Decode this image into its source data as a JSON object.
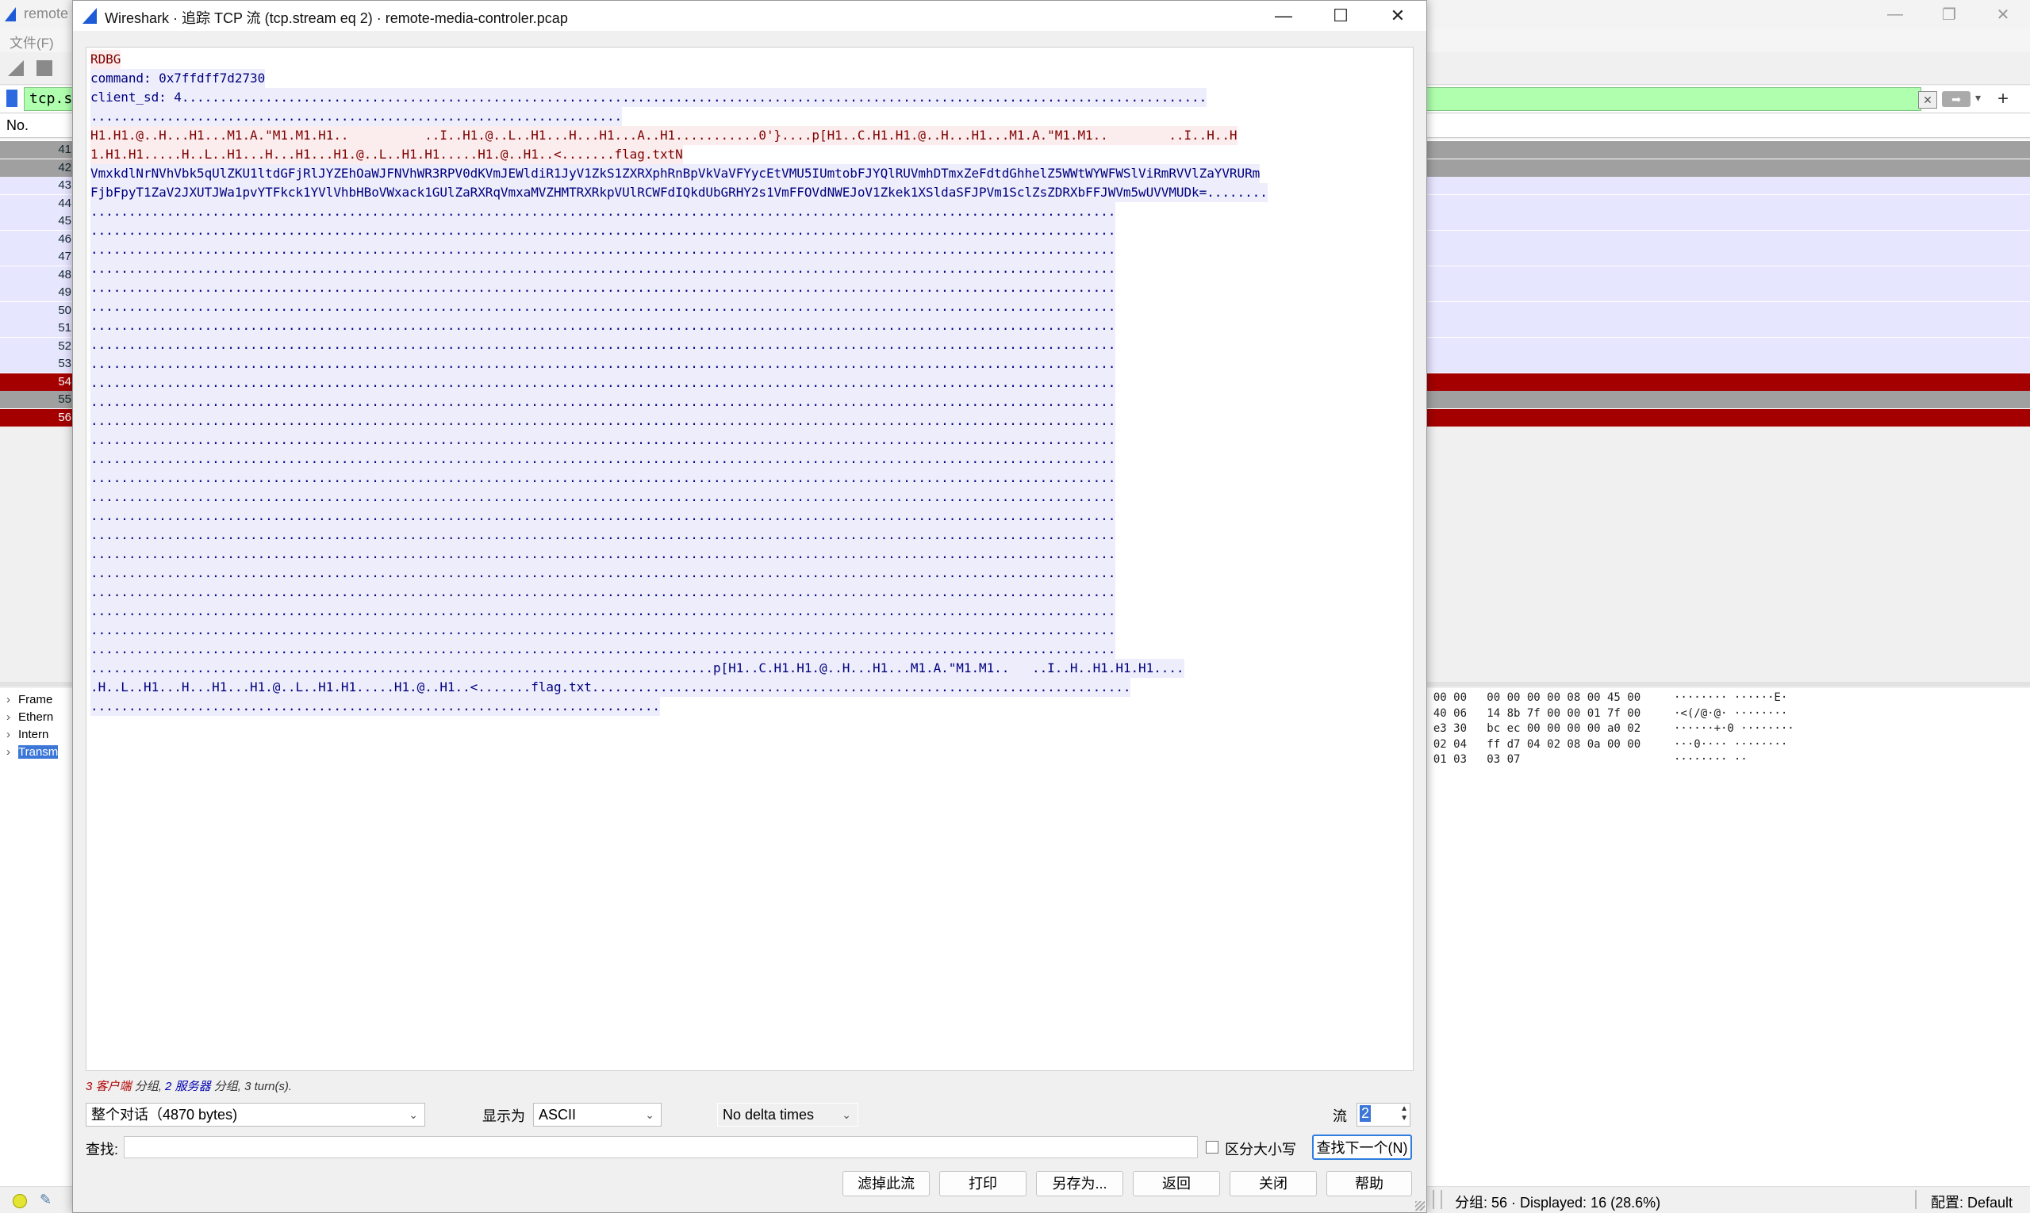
{
  "background": {
    "title": "remote",
    "menu_file": "文件(F)",
    "filter_text": "tcp.str",
    "packet_header_no": "No.",
    "packet_numbers": [
      "41",
      "42",
      "43",
      "44",
      "45",
      "46",
      "47",
      "48",
      "49",
      "50",
      "51",
      "52",
      "53",
      "54",
      "55",
      "56"
    ],
    "tree_items": [
      "Frame",
      "Ethern",
      "Intern",
      "Transm"
    ],
    "hex_lines": [
      "0 00 00   00 00 00 00 08 00 45 00",
      "0 40 06   14 8b 7f 00 00 01 7f 00",
      "0 e3 30   bc ec 00 00 00 00 a0 02",
      "0 02 04   ff d7 04 02 08 0a 00 00",
      "0 01 03   03 07"
    ],
    "ascii_lines": [
      "········ ······E·",
      "·<(/@·@· ········",
      "······+·0 ········",
      "···0···· ········",
      "········ ··"
    ],
    "status_packets": "分组: 56 · Displayed: 16 (28.6%)",
    "status_profile": "配置: Default",
    "colors": {
      "filter_ok": "#afffaf",
      "client": "#7f0000",
      "server": "#00007f",
      "bad_row": "#a40000"
    }
  },
  "dialog": {
    "title": "Wireshark · 追踪 TCP 流 (tcp.stream eq 2) · remote-media-controler.pcap",
    "stream_lines": [
      {
        "t": "RDBG",
        "s": "c"
      },
      {
        "t": "command: 0x7ffdff7d2730",
        "s": "s"
      },
      {
        "t": "client_sd: 4.......................................................................................................................................",
        "s": "s"
      },
      {
        "t": "......................................................................",
        "s": "s"
      },
      {
        "t": "H1.H1.@..H...H1...M1.A.\"M1.M1.H1..          ..I..H1.@..L..H1...H...H1...A..H1...........0'}....p[H1..C.H1.H1.@..H...H1...M1.A.\"M1.M1..        ..I..H..H",
        "s": "c"
      },
      {
        "t": "1.H1.H1.....H..L..H1...H...H1...H1.@..L..H1.H1.....H1.@..H1..<.......flag.txtN",
        "s": "c"
      },
      {
        "t": "VmxkdlNrNVhVbk5qUlZKU1ltdGFjRlJYZEhOaWJFNVhWR3RPV0dKVmJEWldiR1JyV1ZkS1ZXRXphRnBpVkVaVFYycEtVMU5IUmtobFJYQlRUVmhDTmxZeFdtdGhhelZ5WWtWYWFWSlViRmRVVlZaYVRURm",
        "s": "s"
      },
      {
        "t": "FjbFpyT1ZaV2JXUTJWa1pvYTFkck1YVlVhbHBoVWxack1GUlZaRXRqVmxaMVZHMTRXRkpVUlRCWFdIQkdUbGRHY2s1VmFFOVdNWEJoV1Zkek1XSldaSFJPVm1SclZsZDRXbFFJWVm5wUVVMUDk=........",
        "s": "s"
      },
      {
        "t": ".......................................................................................................................................",
        "s": "s"
      },
      {
        "t": ".......................................................................................................................................",
        "s": "s"
      },
      {
        "t": ".......................................................................................................................................",
        "s": "s"
      },
      {
        "t": ".......................................................................................................................................",
        "s": "s"
      },
      {
        "t": ".......................................................................................................................................",
        "s": "s"
      },
      {
        "t": ".......................................................................................................................................",
        "s": "s"
      },
      {
        "t": ".......................................................................................................................................",
        "s": "s"
      },
      {
        "t": ".......................................................................................................................................",
        "s": "s"
      },
      {
        "t": ".......................................................................................................................................",
        "s": "s"
      },
      {
        "t": ".......................................................................................................................................",
        "s": "s"
      },
      {
        "t": ".......................................................................................................................................",
        "s": "s"
      },
      {
        "t": ".......................................................................................................................................",
        "s": "s"
      },
      {
        "t": ".......................................................................................................................................",
        "s": "s"
      },
      {
        "t": ".......................................................................................................................................",
        "s": "s"
      },
      {
        "t": ".......................................................................................................................................",
        "s": "s"
      },
      {
        "t": ".......................................................................................................................................",
        "s": "s"
      },
      {
        "t": ".......................................................................................................................................",
        "s": "s"
      },
      {
        "t": ".......................................................................................................................................",
        "s": "s"
      },
      {
        "t": ".......................................................................................................................................",
        "s": "s"
      },
      {
        "t": ".......................................................................................................................................",
        "s": "s"
      },
      {
        "t": ".......................................................................................................................................",
        "s": "s"
      },
      {
        "t": ".......................................................................................................................................",
        "s": "s"
      },
      {
        "t": ".......................................................................................................................................",
        "s": "s"
      },
      {
        "t": ".......................................................................................................................................",
        "s": "s"
      },
      {
        "t": "..................................................................................p[H1..C.H1.H1.@..H...H1...M1.A.\"M1.M1..   ..I..H..H1.H1.H1....",
        "s": "s"
      },
      {
        "t": ".H..L..H1...H...H1...H1.@..L..H1.H1.....H1.@..H1..<.......flag.txt.......................................................................",
        "s": "s"
      },
      {
        "t": "...........................................................................",
        "s": "s"
      }
    ],
    "summary": {
      "client_count": "3",
      "client_word": "客户端",
      "mid1": " 分组, ",
      "server_count": "2",
      "server_word": "服务器",
      "tail": " 分组, 3 turn(s)."
    },
    "conversation_select": "整个对话（4870 bytes)",
    "show_as_label": "显示为",
    "show_as_value": "ASCII",
    "delta_value": "No delta times",
    "stream_label": "流",
    "stream_value": "2",
    "find_label": "查找:",
    "find_value": "",
    "case_label": "区分大小写",
    "find_next": "查找下一个(N)",
    "buttons": {
      "filter_out": "滤掉此流",
      "print": "打印",
      "save_as": "另存为...",
      "back": "返回",
      "close": "关闭",
      "help": "帮助"
    }
  }
}
